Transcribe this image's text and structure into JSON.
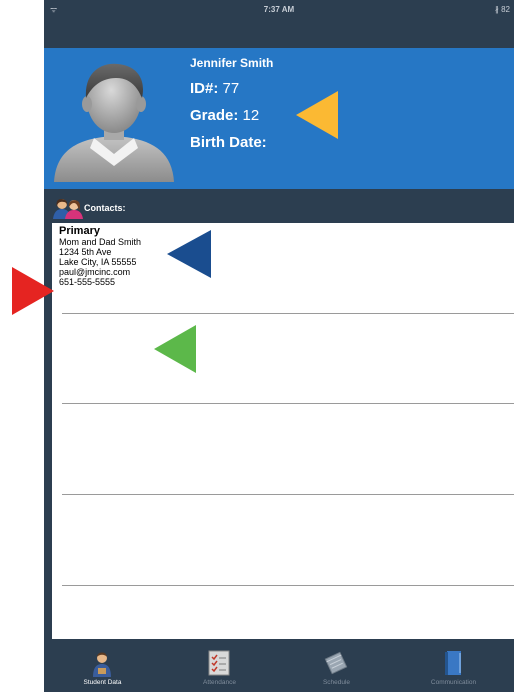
{
  "status_bar": {
    "wifi": "ᯤ",
    "time": "7:37 AM",
    "battery": "∦ 82"
  },
  "student": {
    "name": "Jennifer Smith",
    "id_label": "ID#:",
    "id_value": "77",
    "grade_label": "Grade:",
    "grade_value": "12",
    "birth_label": "Birth Date:",
    "birth_value": ""
  },
  "contacts": {
    "section_label": "Contacts:",
    "items": [
      {
        "type": "Primary",
        "names": "Mom and Dad Smith",
        "street": "1234 5th Ave",
        "city": "Lake City, IA  55555",
        "email": "paul@jmcinc.com",
        "phone": "651-555-5555"
      }
    ]
  },
  "tabs": [
    {
      "label": "Student Data",
      "icon": "student-icon",
      "active": true
    },
    {
      "label": "Attendance",
      "icon": "checklist-icon",
      "active": false
    },
    {
      "label": "Schedule",
      "icon": "notebook-icon",
      "active": false
    },
    {
      "label": "Communication",
      "icon": "book-icon",
      "active": false
    }
  ],
  "annotation_colors": {
    "yellow": "#fbb933",
    "dark_blue": "#1a4d8f",
    "red": "#e52421",
    "green": "#5cb84a"
  }
}
